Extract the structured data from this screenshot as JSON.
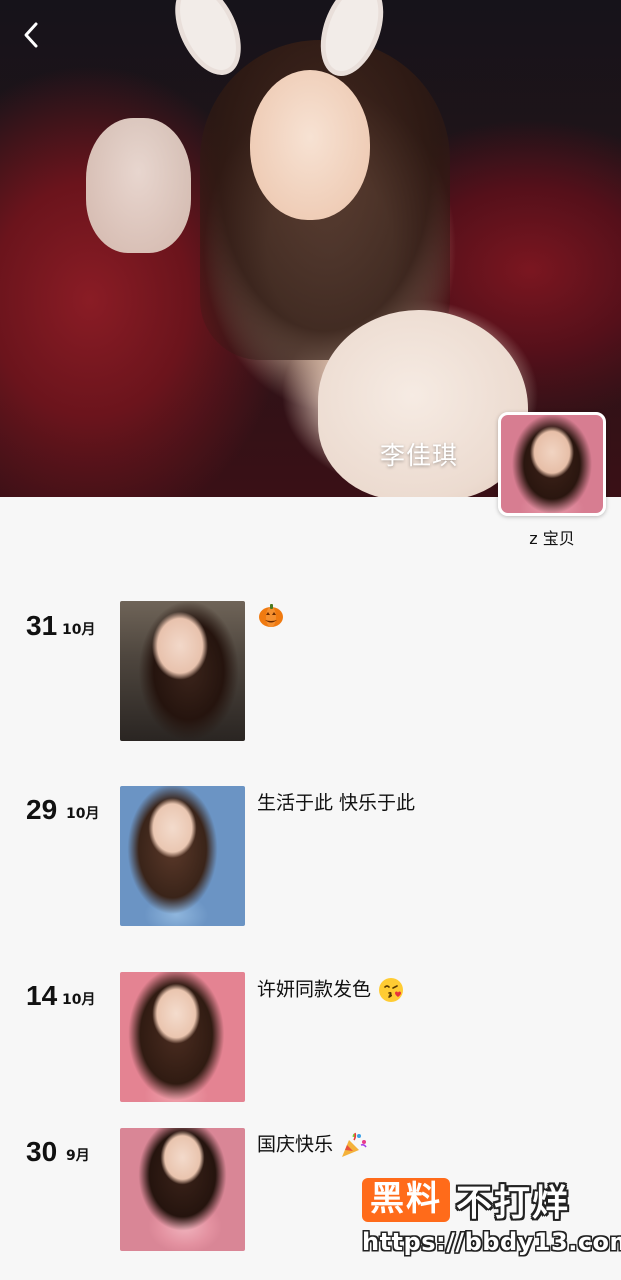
{
  "header": {
    "cover_name": "李佳琪"
  },
  "profile": {
    "avatar_name": "z 宝贝"
  },
  "posts": [
    {
      "day": "31",
      "month": "10月",
      "caption": "",
      "emoji": "pumpkin-emoji"
    },
    {
      "day": "29",
      "month": "10月",
      "caption": "生活于此 快乐于此",
      "emoji": ""
    },
    {
      "day": "14",
      "month": "10月",
      "caption": "许妍同款发色",
      "emoji": "kiss-emoji"
    },
    {
      "day": "30",
      "month": "9月",
      "caption": "国庆快乐",
      "emoji": "party-popper-emoji"
    }
  ],
  "watermark": {
    "badge": "黑料",
    "rest": "不打烊",
    "url": "https://bbdy13.com"
  },
  "colors": {
    "background": "#f7f7f7",
    "text": "#111111",
    "watermark_orange": "#ff6b1a"
  }
}
